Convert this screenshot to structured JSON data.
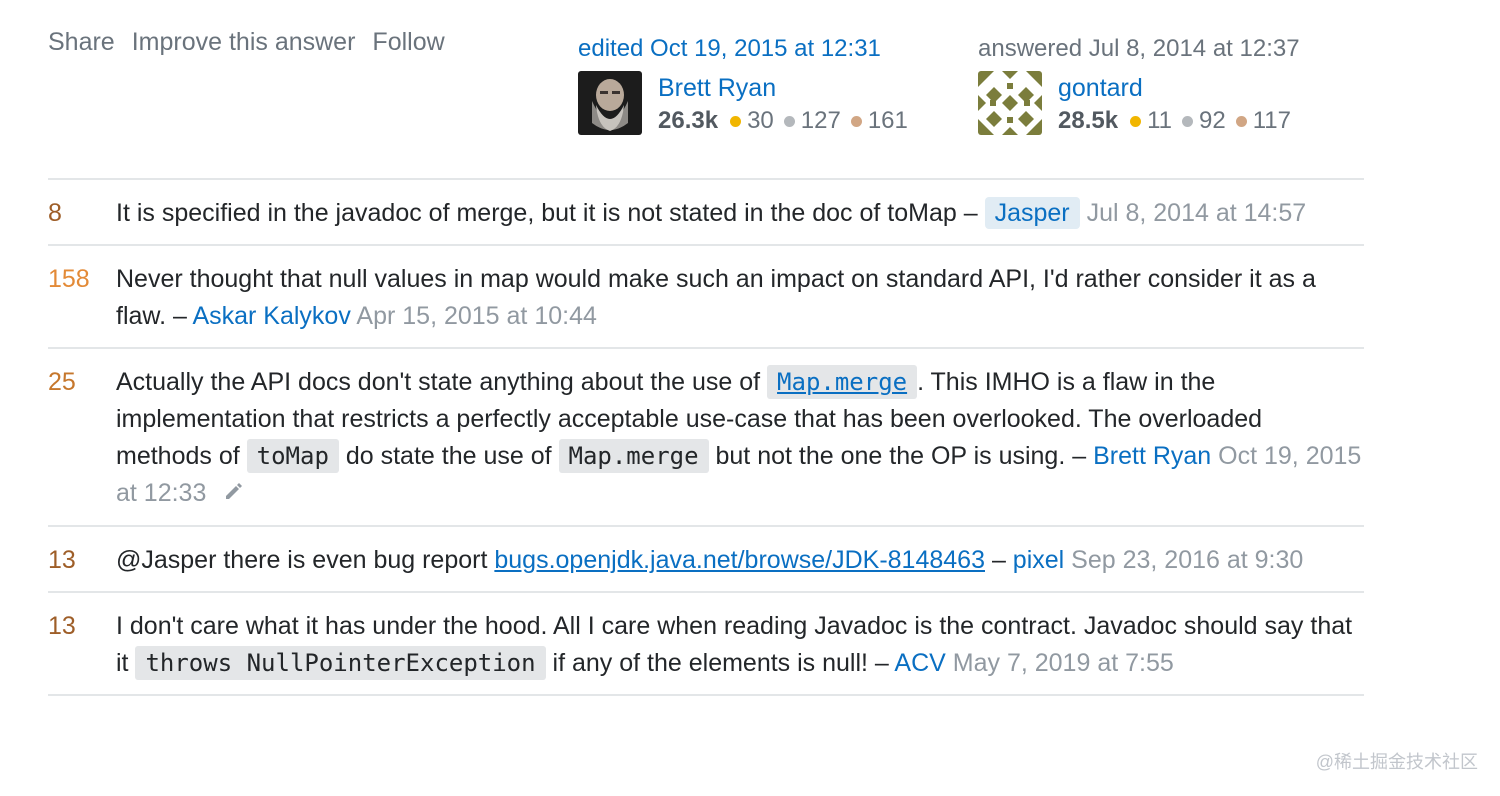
{
  "post_menu": {
    "share": "Share",
    "improve": "Improve this answer",
    "follow": "Follow"
  },
  "editor": {
    "action": "edited Oct 19, 2015 at 12:31",
    "name": "Brett Ryan",
    "reputation": "26.3k",
    "gold": "30",
    "silver": "127",
    "bronze": "161"
  },
  "owner": {
    "action": "answered Jul 8, 2014 at 12:37",
    "name": "gontard",
    "reputation": "28.5k",
    "gold": "11",
    "silver": "92",
    "bronze": "117"
  },
  "badge_colors": {
    "gold": "#f1b600",
    "silver": "#b4b8bc",
    "bronze": "#d1a684"
  },
  "comments": [
    {
      "score": "8",
      "score_color": "#9e5e28",
      "text": "It is specified in the javadoc of merge, but it is not stated in the doc of toMap –",
      "user": "Jasper",
      "date": "Jul 8, 2014 at 14:57"
    },
    {
      "score": "158",
      "score_color": "#e38a37",
      "text": "Never thought that null values in map would make such an impact on standard API, I'd rather consider it as a flaw. –",
      "user": "Askar Kalykov",
      "date": "Apr 15, 2015 at 10:44"
    },
    {
      "score": "25",
      "score_color": "#c6772c",
      "text_1": "Actually the API docs don't state anything about the use of",
      "code_1": "Map.merge",
      "text_2": ". This IMHO is a flaw in the implementation that restricts a perfectly acceptable use-case that has been overlooked. The overloaded methods of",
      "code_2": "toMap",
      "text_3": "do state the use of",
      "code_3": "Map.merge",
      "text_4": "but not the one the OP is using. –",
      "user": "Brett Ryan",
      "date": "Oct 19, 2015 at 12:33"
    },
    {
      "score": "13",
      "score_color": "#9e5e28",
      "text_1": "@Jasper there is even bug report",
      "link": "bugs.openjdk.java.net/browse/JDK-8148463",
      "text_2": "–",
      "user": "pixel",
      "date": "Sep 23, 2016 at 9:30"
    },
    {
      "score": "13",
      "score_color": "#9e5e28",
      "text_1": "I don't care what it has under the hood. All I care when reading Javadoc is the contract. Javadoc should say that it",
      "code_1": "throws NullPointerException",
      "text_2": "if any of the elements is null! –",
      "user": "ACV",
      "date": "May 7, 2019 at 7:55"
    }
  ],
  "watermark": "@稀土掘金技术社区"
}
